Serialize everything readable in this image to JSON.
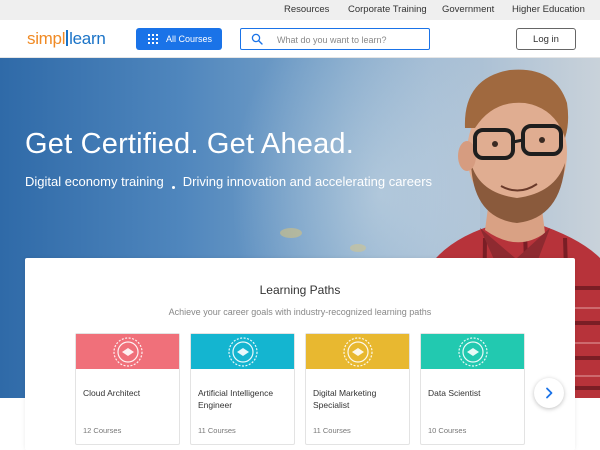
{
  "top_nav": {
    "items": [
      "Resources",
      "Corporate Training",
      "Government",
      "Higher Education"
    ]
  },
  "header": {
    "logo_left": "simpl",
    "logo_right": "learn",
    "all_courses_label": "All Courses",
    "search_placeholder": "What do you want to learn?",
    "login_label": "Log in"
  },
  "hero": {
    "title": "Get Certified. Get Ahead.",
    "subtitle_part1": "Digital economy training",
    "subtitle_part2": "Driving innovation and accelerating careers"
  },
  "learning_paths": {
    "title": "Learning Paths",
    "subtitle": "Achieve your career goals with industry-recognized learning paths",
    "cards": [
      {
        "name": "Cloud Architect",
        "courses": "12 Courses",
        "color": "#f0707a"
      },
      {
        "name": "Artificial Intelligence Engineer",
        "courses": "11 Courses",
        "color": "#14b5d0"
      },
      {
        "name": "Digital Marketing Specialist",
        "courses": "11 Courses",
        "color": "#e8b830"
      },
      {
        "name": "Data Scientist",
        "courses": "10 Courses",
        "color": "#22c9b0"
      }
    ]
  },
  "colors": {
    "brand_orange": "#f08a24",
    "brand_blue": "#1a73e8"
  },
  "icons": [
    "grid-icon",
    "search-icon",
    "chevron-right-icon",
    "masters-program-badge-icon"
  ]
}
